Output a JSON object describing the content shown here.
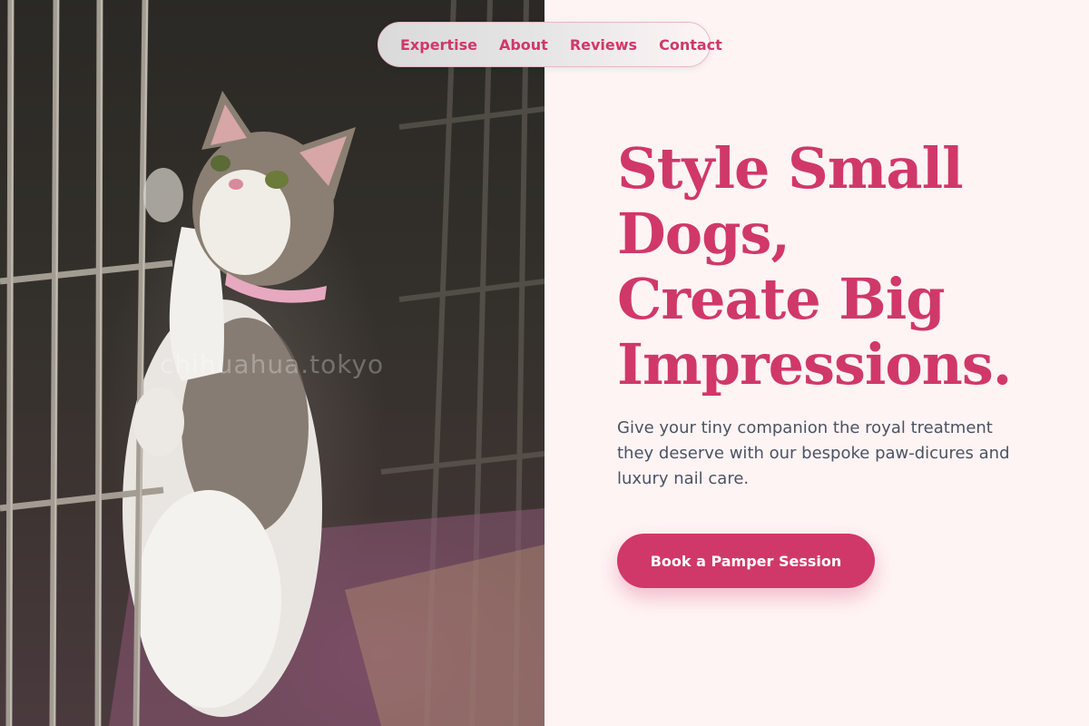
{
  "nav": {
    "items": [
      {
        "label": "Expertise"
      },
      {
        "label": "About"
      },
      {
        "label": "Reviews"
      },
      {
        "label": "Contact"
      }
    ]
  },
  "hero": {
    "headline_lines": [
      "Style Small",
      "Dogs,",
      "Create Big",
      "Impressions."
    ],
    "description": "Give your tiny companion the royal treatment they deserve with our bespoke paw-dicures and luxury nail care.",
    "cta_label": "Book a Pamper Session"
  },
  "photo": {
    "watermark": "chihuahua.tokyo"
  },
  "colors": {
    "accent": "#d0386a",
    "background": "#fff4f4",
    "body_text": "#4b5363"
  }
}
